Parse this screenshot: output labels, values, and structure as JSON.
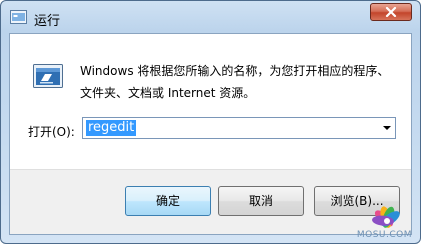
{
  "window": {
    "title": "运行",
    "close_icon": "close-icon",
    "app_icon": "run-app-icon"
  },
  "dialog": {
    "run_icon": "run-program-icon",
    "description": "Windows 将根据您所输入的名称，为您打开相应的程序、文件夹、文档或 Internet 资源。",
    "open_label": "打开(O):",
    "open_value": "regedit"
  },
  "buttons": {
    "ok": "确定",
    "cancel": "取消",
    "browse": "浏览(B)..."
  },
  "watermark": {
    "text": "MOSU.COM"
  },
  "colors": {
    "frame": "#bcd4ec",
    "close_button": "#c3452b",
    "selection": "#3399ff"
  }
}
